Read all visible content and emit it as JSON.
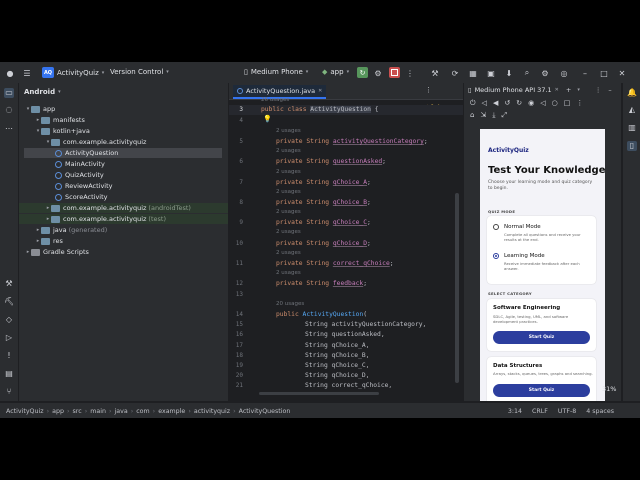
{
  "titlebar": {
    "project_badge": "AQ",
    "project_name": "ActivityQuiz",
    "version_control": "Version Control",
    "device": "Medium Phone",
    "run_config": "app"
  },
  "project_panel": {
    "header": "Android",
    "tree": [
      {
        "label": "app",
        "level": 0,
        "kind": "folder"
      },
      {
        "label": "manifests",
        "level": 1,
        "kind": "folder"
      },
      {
        "label": "kotlin+java",
        "level": 1,
        "kind": "folder"
      },
      {
        "label": "com.example.activityquiz",
        "level": 2,
        "kind": "folder"
      },
      {
        "label": "ActivityQuestion",
        "level": 3,
        "kind": "class",
        "selected": true
      },
      {
        "label": "MainActivity",
        "level": 3,
        "kind": "class"
      },
      {
        "label": "QuizActivity",
        "level": 3,
        "kind": "class"
      },
      {
        "label": "ReviewActivity",
        "level": 3,
        "kind": "class"
      },
      {
        "label": "ScoreActivity",
        "level": 3,
        "kind": "class"
      },
      {
        "label": "com.example.activityquiz",
        "suffix": "(androidTest)",
        "level": 2,
        "kind": "folder"
      },
      {
        "label": "com.example.activityquiz",
        "suffix": "(test)",
        "level": 2,
        "kind": "folder"
      },
      {
        "label": "java",
        "suffix": "(generated)",
        "level": 1,
        "kind": "folder"
      },
      {
        "label": "res",
        "level": 1,
        "kind": "folder"
      },
      {
        "label": "Gradle Scripts",
        "level": 0,
        "kind": "gradle"
      }
    ]
  },
  "editor": {
    "tab_label": "ActivityQuestion.java",
    "warnings": "9",
    "hints": {
      "h26": "26 usages",
      "h2": "2 usages",
      "h20": "20 usages"
    },
    "lines": {
      "l3_kw": "public class",
      "l3_name": "ActivityQuestion",
      "l3_tail": " {",
      "priv": "private String",
      "f5": "activityQuestionCategory",
      "f6": "questionAsked",
      "f7": "qChoice_A",
      "f8": "qChoice_B",
      "f9": "qChoice_C",
      "f10": "qChoice_D",
      "f11": "correct_qChoice",
      "f12": "feedback",
      "semi": ";",
      "l14_kw": "public",
      "l14_fn": "ActivityQuestion",
      "l14_tail": "(",
      "p15": "String activityQuestionCategory,",
      "p16": "String questionAsked,",
      "p17": "String qChoice_A,",
      "p18": "String qChoice_B,",
      "p19": "String qChoice_C,",
      "p20": "String qChoice_D,",
      "p21": "String correct_qChoice,"
    },
    "line_numbers": [
      "3",
      "4",
      "5",
      "6",
      "7",
      "8",
      "9",
      "10",
      "11",
      "12",
      "13",
      "14",
      "15",
      "16",
      "17",
      "18",
      "19",
      "20",
      "21"
    ]
  },
  "device_panel": {
    "title": "Medium Phone API 37.1",
    "app_title": "ActivityQuiz",
    "heading": "Test Your Knowledge",
    "subtitle": "Choose your learning mode and quiz category to begin.",
    "mode_section": "QUIZ MODE",
    "normal_mode": "Normal Mode",
    "normal_desc": "Complete all questions and receive your results at the end.",
    "learning_mode": "Learning Mode",
    "learning_desc": "Receive immediate feedback after each answer.",
    "category_section": "SELECT CATEGORY",
    "cat1_title": "Software Engineering",
    "cat1_desc": "SDLC, Agile, testing, UML, and software development practices.",
    "cat2_title": "Data Structures",
    "cat2_desc": "Arrays, stacks, queues, trees, graphs and searching.",
    "start_label": "Start Quiz",
    "zoom": "31%"
  },
  "statusbar": {
    "crumbs": [
      "ActivityQuiz",
      "app",
      "src",
      "main",
      "java",
      "com",
      "example",
      "activityquiz",
      "ActivityQuestion"
    ],
    "position": "3:14",
    "line_sep": "CRLF",
    "encoding": "UTF-8",
    "indent": "4 spaces"
  }
}
